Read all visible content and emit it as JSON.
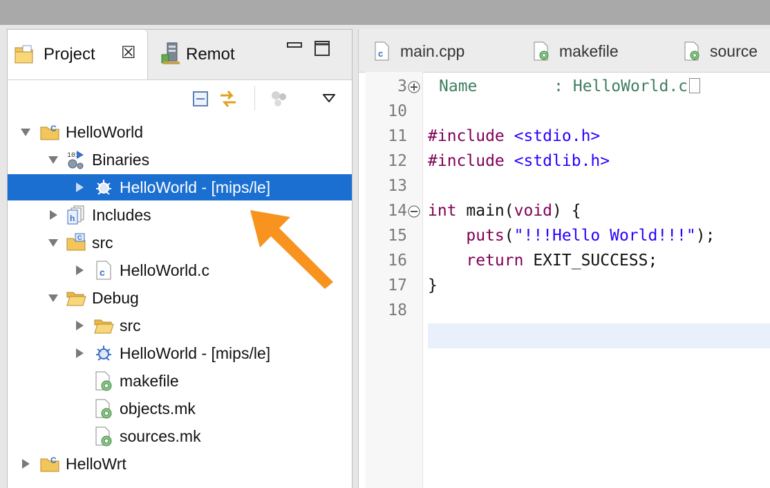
{
  "project_explorer": {
    "tabs": [
      {
        "label": "Project",
        "close": "☒"
      },
      {
        "label": "Remot"
      }
    ],
    "tree": [
      {
        "label": "HelloWorld"
      },
      {
        "label": "Binaries"
      },
      {
        "label": "HelloWorld - [mips/le]"
      },
      {
        "label": "Includes"
      },
      {
        "label": "src"
      },
      {
        "label": "HelloWorld.c"
      },
      {
        "label": "Debug"
      },
      {
        "label": "src"
      },
      {
        "label": "HelloWorld - [mips/le]"
      },
      {
        "label": "makefile"
      },
      {
        "label": "objects.mk"
      },
      {
        "label": "sources.mk"
      },
      {
        "label": "HelloWrt"
      }
    ]
  },
  "editor": {
    "tabs": [
      {
        "label": "main.cpp"
      },
      {
        "label": "makefile"
      },
      {
        "label": "source"
      }
    ],
    "lines": [
      {
        "num": "3",
        "parts": [
          "Name",
          "        : HelloWorld.c"
        ]
      },
      {
        "num": "10"
      },
      {
        "num": "11",
        "parts": [
          "#include",
          "<stdio.h>"
        ]
      },
      {
        "num": "12",
        "parts": [
          "#include",
          "<stdlib.h>"
        ]
      },
      {
        "num": "13"
      },
      {
        "num": "14",
        "parts": [
          "int",
          " main(",
          "void",
          ") {"
        ]
      },
      {
        "num": "15",
        "parts": [
          "    ",
          "puts",
          "(",
          "\"!!!Hello World!!!\"",
          ");"
        ]
      },
      {
        "num": "16",
        "parts": [
          "    ",
          "return",
          " EXIT_SUCCESS;"
        ]
      },
      {
        "num": "17",
        "parts": [
          "}"
        ]
      },
      {
        "num": "18"
      }
    ]
  },
  "colors": {
    "selection": "#1a6fd1",
    "keyword": "#7f0055",
    "string": "#2a00ff",
    "annotation_arrow": "#f7931e"
  }
}
